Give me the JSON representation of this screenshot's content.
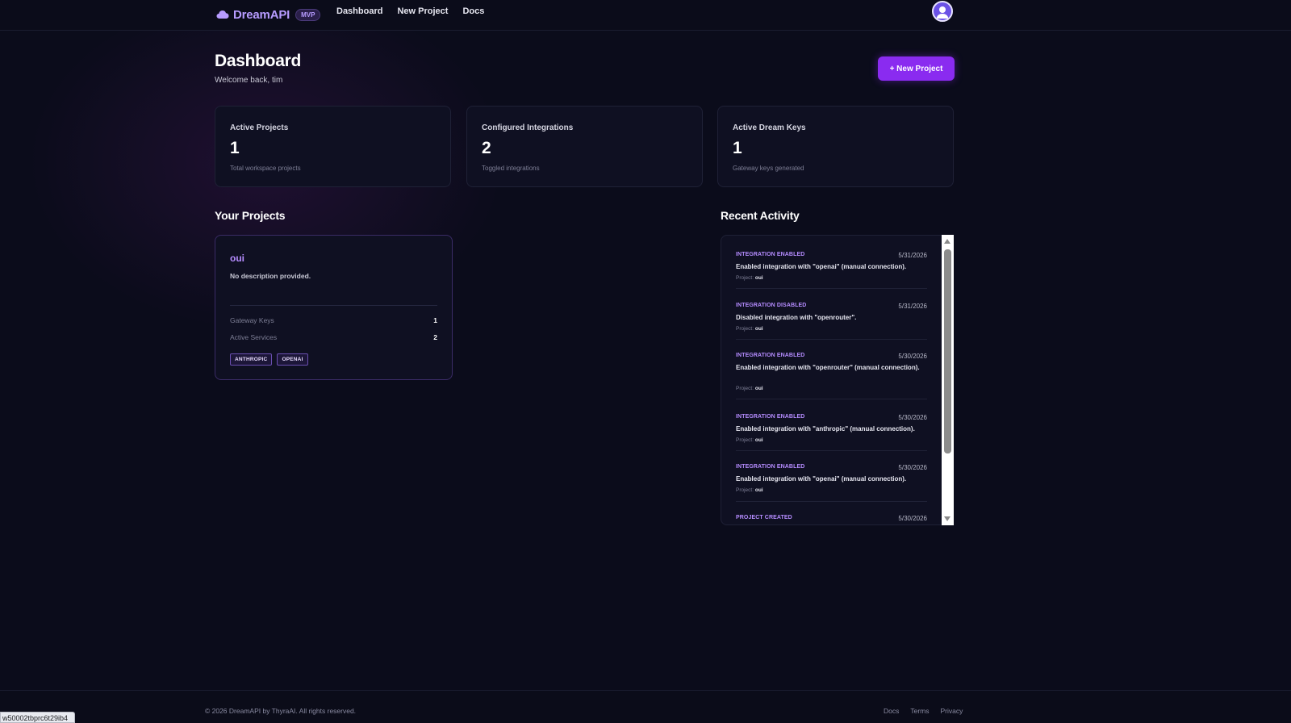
{
  "nav": {
    "brand": "DreamAPI",
    "badge": "MVP",
    "links": [
      "Dashboard",
      "New Project",
      "Docs"
    ]
  },
  "header": {
    "title": "Dashboard",
    "subtitle": "Welcome back, tim",
    "new_project_label": "+ New Project"
  },
  "stats": [
    {
      "label": "Active Projects",
      "value": "1",
      "hint": "Total workspace projects"
    },
    {
      "label": "Configured Integrations",
      "value": "2",
      "hint": "Toggled integrations"
    },
    {
      "label": "Active Dream Keys",
      "value": "1",
      "hint": "Gateway keys generated"
    }
  ],
  "projects_section": {
    "title": "Your Projects",
    "project": {
      "name": "oui",
      "description": "No description provided.",
      "gateway_keys_label": "Gateway Keys",
      "gateway_keys_value": "1",
      "active_services_label": "Active Services",
      "active_services_value": "2",
      "tags": [
        "ANTHROPIC",
        "OPENAI"
      ]
    }
  },
  "activity_section": {
    "title": "Recent Activity",
    "project_prefix": "Project:",
    "items": [
      {
        "type": "INTEGRATION ENABLED",
        "date": "5/31/2026",
        "message": "Enabled integration with \"openai\" (manual connection).",
        "project": "oui"
      },
      {
        "type": "INTEGRATION DISABLED",
        "date": "5/31/2026",
        "message": "Disabled integration with \"openrouter\".",
        "project": "oui"
      },
      {
        "type": "INTEGRATION ENABLED",
        "date": "5/30/2026",
        "message": "Enabled integration with \"openrouter\" (manual connection).",
        "project": "oui"
      },
      {
        "type": "INTEGRATION ENABLED",
        "date": "5/30/2026",
        "message": "Enabled integration with \"anthropic\" (manual connection).",
        "project": "oui"
      },
      {
        "type": "INTEGRATION ENABLED",
        "date": "5/30/2026",
        "message": "Enabled integration with \"openai\" (manual connection).",
        "project": "oui"
      },
      {
        "type": "PROJECT CREATED",
        "date": "5/30/2026",
        "message": "",
        "project": ""
      }
    ]
  },
  "footer": {
    "copyright": "© 2026 DreamAPI by ThyraAI. All rights reserved.",
    "links": [
      "Docs",
      "Terms",
      "Privacy"
    ]
  },
  "status_url": "w50002tbprc6t29ib4"
}
